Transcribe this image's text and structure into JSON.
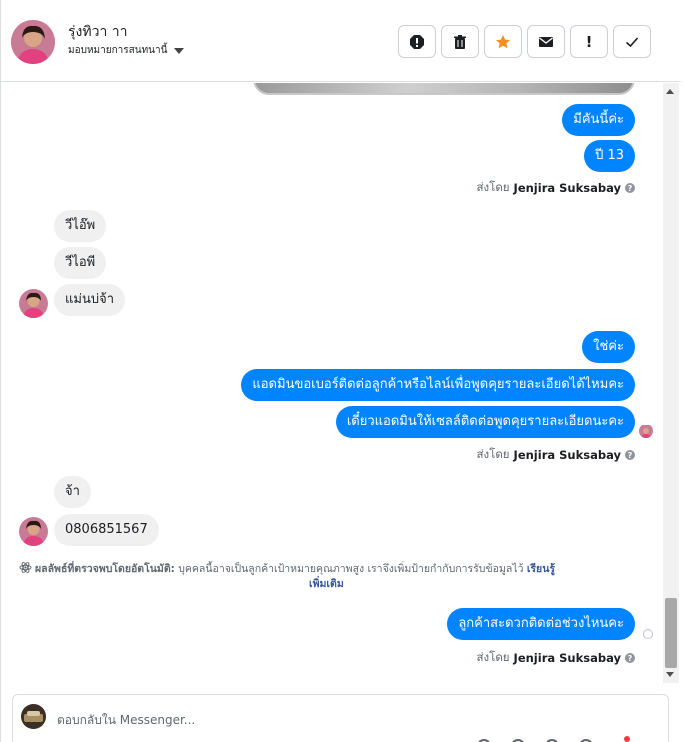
{
  "header": {
    "contact_name": "รุ่งทิวา าา",
    "assign_label": "มอบหมายการสนทนานี้",
    "actions": [
      {
        "name": "spam-icon",
        "symbol": "!"
      },
      {
        "name": "trash-icon",
        "symbol": ""
      },
      {
        "name": "star-icon",
        "symbol": ""
      },
      {
        "name": "envelope-icon",
        "symbol": ""
      },
      {
        "name": "exclamation-icon",
        "symbol": "!"
      },
      {
        "name": "checkmark-icon",
        "symbol": ""
      }
    ]
  },
  "messages": {
    "m1": "มีคันนี้ค่ะ",
    "m2": "ปี 13",
    "sent1_prefix": "ส่งโดย",
    "sent1_name": "Jenjira Suksabay",
    "in1": "วีไอ๊พ",
    "in2": "วีไอพี",
    "in3": "แม่นบ่จ้า",
    "m3": "ใช่ค่ะ",
    "m4": "แอดมินขอเบอร์ติดต่อลูกค้าหรือไลน์เพื่อพูดคุยรายละเอียดได้ไหมคะ",
    "m5": "เดี๋ยวแอดมินให้เซลล์ติดต่อพูดคุยรายละเอียดนะคะ",
    "sent2_prefix": "ส่งโดย",
    "sent2_name": "Jenjira Suksabay",
    "in4": "จ้า",
    "in5": "0806851567",
    "auto_title": "ผลลัพธ์ที่ตรวจพบโดยอัตโนมัติ:",
    "auto_body": " บุคคลนี้อาจเป็นลูกค้าเป้าหมายคุณภาพสูง เราจึงเพิ่มป้ายกำกับการรับข้อมูลไว้ ",
    "auto_learn_1": "เรียนรู้",
    "auto_learn_2": "เพิ่มเติม",
    "m6": "ลูกค้าสะดวกติดต่อช่วงไหนคะ",
    "sent3_prefix": "ส่งโดย",
    "sent3_name": "Jenjira Suksabay"
  },
  "composer": {
    "placeholder": "ตอบกลับใน Messenger..."
  },
  "colors": {
    "outgoing": "#0084ff",
    "incoming": "#f0f0f0",
    "star": "#f28f1f"
  }
}
